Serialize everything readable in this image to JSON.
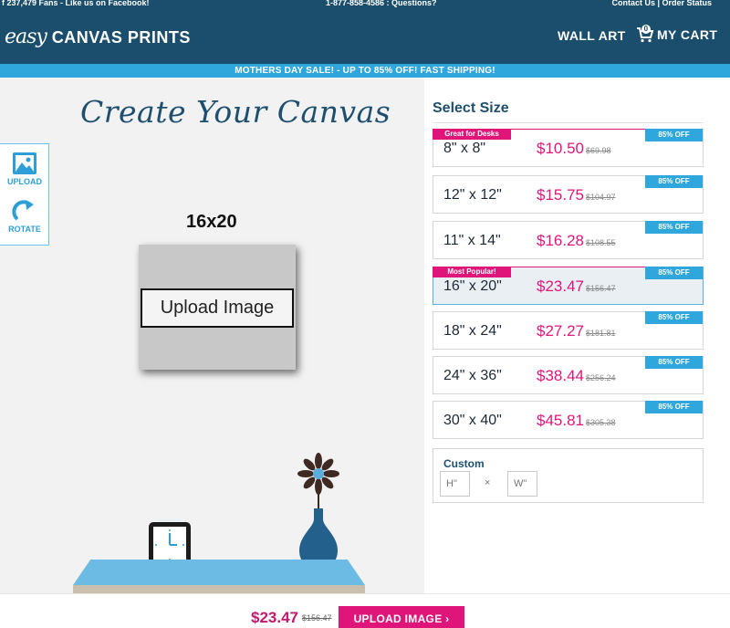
{
  "topbar": {
    "facebook": "237,479 Fans - Like us on Facebook!",
    "phone": "1-877-858-4586 : Questions?",
    "links": "Contact Us | Order Status"
  },
  "header": {
    "logo_easy": "easy",
    "logo_rest": "CANVAS PRINTS",
    "wall_art": "WALL ART",
    "cart_label": "MY CART",
    "cart_count": "0"
  },
  "promo": "MOTHERS DAY SALE! - UP TO 85% OFF! FAST SHIPPING!",
  "canvas": {
    "title": "Create Your Canvas",
    "tools": {
      "upload": "UPLOAD",
      "rotate": "ROTATE"
    },
    "selected_size": "16x20",
    "upload_button": "Upload Image"
  },
  "sizes": {
    "title": "Select Size",
    "rows": [
      {
        "dim": "8\" x 8\"",
        "price": "$10.50",
        "old": "$69.98",
        "off": "85% OFF",
        "tag": "Great for Desks"
      },
      {
        "dim": "12\" x 12\"",
        "price": "$15.75",
        "old": "$104.97",
        "off": "85% OFF",
        "tag": ""
      },
      {
        "dim": "11\" x 14\"",
        "price": "$16.28",
        "old": "$108.55",
        "off": "85% OFF",
        "tag": ""
      },
      {
        "dim": "16\" x 20\"",
        "price": "$23.47",
        "old": "$156.47",
        "off": "85% OFF",
        "tag": "Most Popular!"
      },
      {
        "dim": "18\" x 24\"",
        "price": "$27.27",
        "old": "$181.81",
        "off": "85% OFF",
        "tag": ""
      },
      {
        "dim": "24\" x 36\"",
        "price": "$38.44",
        "old": "$256.24",
        "off": "85% OFF",
        "tag": ""
      },
      {
        "dim": "30\" x 40\"",
        "price": "$45.81",
        "old": "$305.38",
        "off": "85% OFF",
        "tag": ""
      }
    ],
    "custom": {
      "title": "Custom",
      "h_placeholder": "H\"",
      "w_placeholder": "W\"",
      "times": "×"
    }
  },
  "footer": {
    "price": "$23.47",
    "old": "$156.47",
    "button": "UPLOAD IMAGE"
  },
  "colors": {
    "header": "#1b4e6d",
    "promo": "#2fa6dc",
    "accent_pink": "#e0157a",
    "title_blue": "#1e4f6f"
  }
}
